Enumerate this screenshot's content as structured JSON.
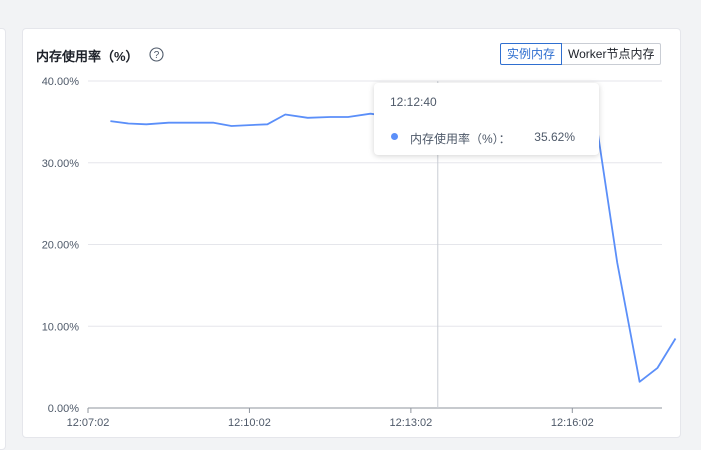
{
  "panel": {
    "title": "内存使用率（%）",
    "help_icon": "question-circle-icon",
    "toggle": {
      "options": [
        "实例内存",
        "Worker节点内存"
      ],
      "selected": "实例内存"
    }
  },
  "tooltip": {
    "time": "12:12:40",
    "series_label": "内存使用率（%）：",
    "value": "35.62%"
  },
  "colors": {
    "line": "#5b8ff9",
    "accent": "#2f6fd0"
  },
  "chart_data": {
    "type": "line",
    "title": "内存使用率（%）",
    "ylim": [
      0,
      40
    ],
    "y_ticks": [
      "0.00%",
      "10.00%",
      "20.00%",
      "30.00%",
      "40.00%"
    ],
    "x_ticks": [
      "12:07:02",
      "12:10:02",
      "12:13:02",
      "12:16:02"
    ],
    "grid": true,
    "x_seconds_from_start": [
      25,
      45,
      65,
      90,
      115,
      140,
      160,
      180,
      200,
      220,
      245,
      270,
      290,
      315,
      340,
      365,
      390,
      410,
      430,
      455,
      480,
      510,
      540,
      565,
      590,
      615,
      635,
      655
    ],
    "values": [
      35.1,
      34.8,
      34.7,
      34.9,
      34.9,
      34.9,
      34.5,
      34.6,
      34.7,
      35.9,
      35.5,
      35.6,
      35.6,
      36.0,
      35.6,
      35.6,
      35.62,
      35.6,
      35.7,
      35.6,
      36.4,
      35.4,
      35.5,
      36.2,
      17.8,
      3.2,
      4.9,
      8.5
    ]
  }
}
